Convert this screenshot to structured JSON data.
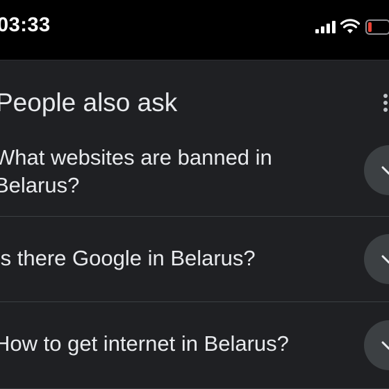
{
  "status_bar": {
    "time": "03:33",
    "signal_icon": "cellular-signal-icon",
    "wifi_icon": "wifi-icon",
    "battery_icon": "battery-low-icon",
    "battery_color": "#ea4335"
  },
  "people_also_ask": {
    "title": "People also ask",
    "more_icon": "more-vertical-icon",
    "questions": [
      {
        "line1": "What websites are banned in",
        "line2": "Belarus?"
      },
      {
        "line1": "Is there Google in Belarus?",
        "line2": ""
      },
      {
        "line1": "How to get internet in Belarus?",
        "line2": ""
      }
    ],
    "expand_icon": "chevron-down-icon"
  },
  "colors": {
    "background": "#000000",
    "card": "#1f2023",
    "text": "#e8eaed",
    "button": "#3c4043",
    "divider": "#3c4043"
  }
}
